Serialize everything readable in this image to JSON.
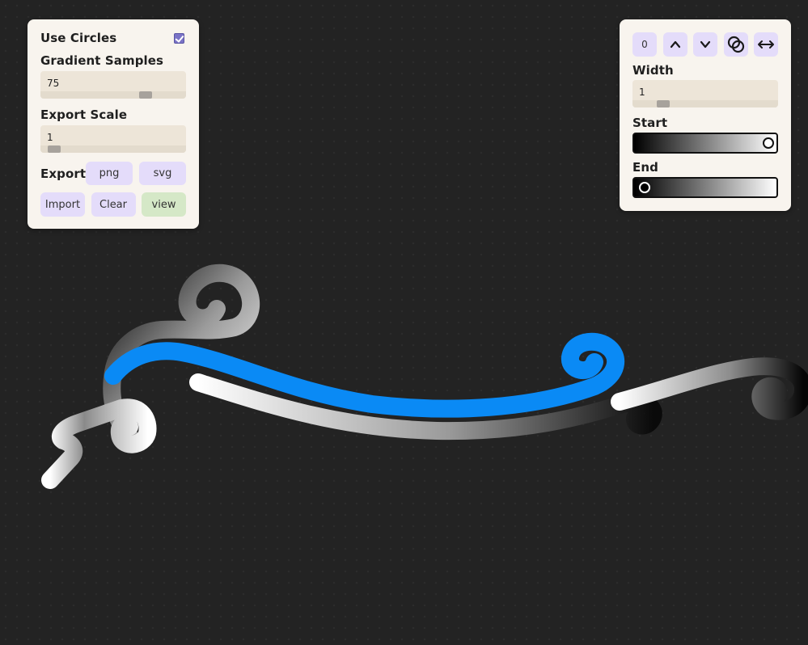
{
  "left_panel": {
    "use_circles_label": "Use Circles",
    "use_circles_checked": true,
    "gradient_samples_label": "Gradient Samples",
    "gradient_samples_value": "75",
    "export_scale_label": "Export Scale",
    "export_scale_value": "1",
    "export_label": "Export",
    "png_label": "png",
    "svg_label": "svg",
    "import_label": "Import",
    "clear_label": "Clear",
    "view_label": "view"
  },
  "right_panel": {
    "counter_value": "0",
    "up_icon": "chevron-up-icon",
    "down_icon": "chevron-down-icon",
    "link_icon": "overlapping-circles-icon",
    "flip_icon": "left-right-arrow-icon",
    "width_label": "Width",
    "width_value": "1",
    "start_label": "Start",
    "end_label": "End"
  },
  "colors": {
    "selected_stroke": "#0a8af5",
    "panel_bg": "#f8f4ee",
    "button_bg": "#e4dcfa",
    "view_button_bg": "#d5e8c7",
    "checkbox": "#7a73c6"
  }
}
